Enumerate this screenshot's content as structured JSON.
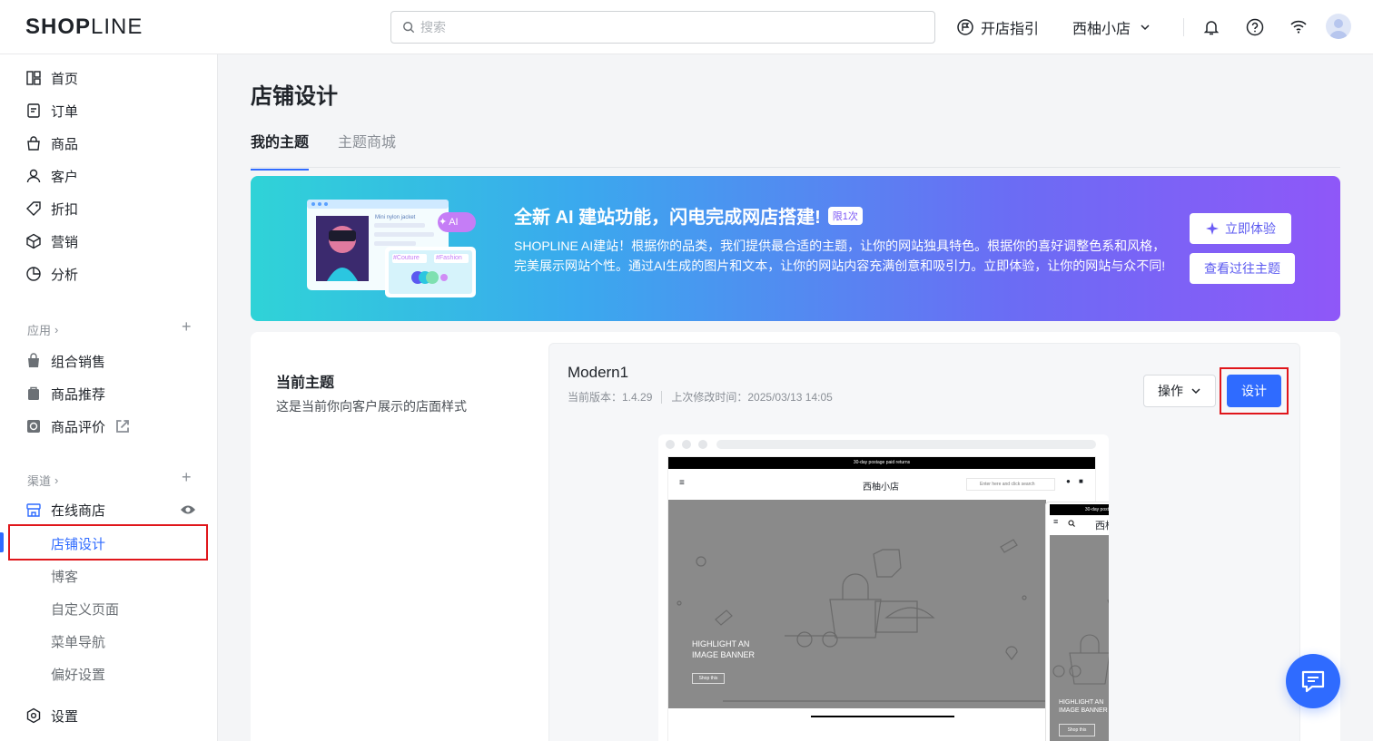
{
  "brand": {
    "logo_main": "SHOP",
    "logo_thin": "LINE"
  },
  "search": {
    "placeholder": "搜索"
  },
  "header": {
    "guide_label": "开店指引",
    "store_name": "西柚小店"
  },
  "sidebar": {
    "main_items": [
      {
        "label": "首页",
        "icon": "dashboard-icon"
      },
      {
        "label": "订单",
        "icon": "order-icon"
      },
      {
        "label": "商品",
        "icon": "bag-icon"
      },
      {
        "label": "客户",
        "icon": "user-icon"
      },
      {
        "label": "折扣",
        "icon": "tag-icon"
      },
      {
        "label": "营销",
        "icon": "cube-icon"
      },
      {
        "label": "分析",
        "icon": "pie-chart-icon"
      }
    ],
    "apps_label": "应用",
    "apps": [
      {
        "label": "组合销售"
      },
      {
        "label": "商品推荐"
      },
      {
        "label": "商品评价"
      }
    ],
    "channels_label": "渠道",
    "online_store": "在线商店",
    "sub_items": [
      {
        "label": "店铺设计"
      },
      {
        "label": "博客"
      },
      {
        "label": "自定义页面"
      },
      {
        "label": "菜单导航"
      },
      {
        "label": "偏好设置"
      }
    ],
    "settings": "设置"
  },
  "page": {
    "title": "店铺设计",
    "tabs": [
      {
        "label": "我的主题"
      },
      {
        "label": "主题商城"
      }
    ]
  },
  "banner": {
    "title": "全新 AI 建站功能，闪电完成网店搭建!",
    "badge": "限1次",
    "description": "SHOPLINE AI建站！根据你的品类，我们提供最合适的主题，让你的网站独具特色。根据你的喜好调整色系和风格，完美展示网站个性。通过AI生成的图片和文本，让你的网站内容充满创意和吸引力。立即体验，让你的网站与众不同!",
    "try_label": "立即体验",
    "history_label": "查看过往主题",
    "illustration": {
      "ai_tag": "AI",
      "tag1": "#Couture",
      "tag2": "#Fashion",
      "caption": "Mini nylon jacket"
    }
  },
  "current_theme": {
    "section_title": "当前主题",
    "section_desc": "这是当前你向客户展示的店面样式",
    "name": "Modern1",
    "version": "当前版本：1.4.29",
    "modified": "上次修改时间：2025/03/13 14:05",
    "ops_label": "操作",
    "design_label": "设计"
  },
  "preview": {
    "announcement": "30-day postage paid returns",
    "store_name": "西柚小店",
    "search_placeholder": "Enter here and click search",
    "banner_line1": "HIGHLIGHT AN",
    "banner_line2": "IMAGE BANNER",
    "shop_btn": "Shop this"
  },
  "colors": {
    "accent": "#2f6bff",
    "highlight_box": "#e0161b"
  }
}
